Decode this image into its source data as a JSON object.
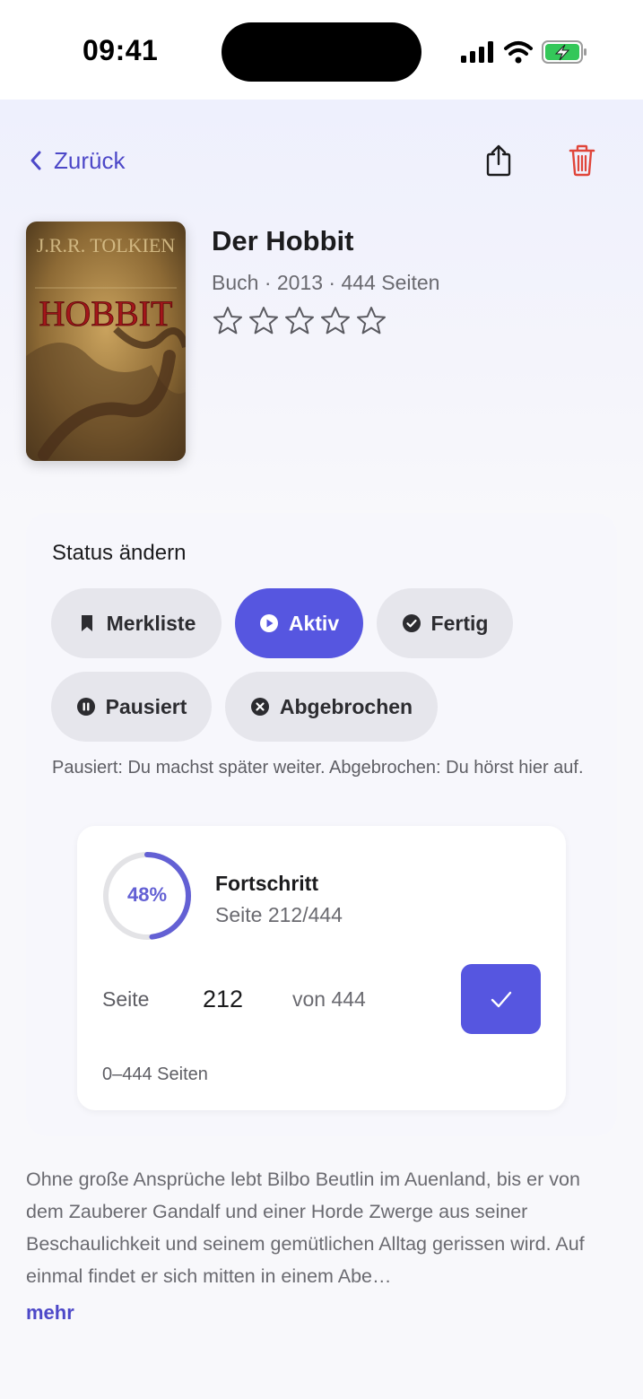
{
  "status_bar": {
    "time": "09:41"
  },
  "nav": {
    "back_label": "Zurück"
  },
  "book": {
    "title": "Der Hobbit",
    "meta": "Buch · 2013 · 444 Seiten",
    "rating": 0,
    "rating_max": 5,
    "cover_text": {
      "author": "J.R.R. TOLKIEN",
      "title": "HOBBIT"
    }
  },
  "status": {
    "heading": "Status ändern",
    "chips": [
      {
        "label": "Merkliste",
        "icon": "bookmark-icon",
        "active": false
      },
      {
        "label": "Aktiv",
        "icon": "play-icon",
        "active": true
      },
      {
        "label": "Fertig",
        "icon": "checkmark-circle-icon",
        "active": false
      },
      {
        "label": "Pausiert",
        "icon": "pause-icon",
        "active": false
      },
      {
        "label": "Abgebrochen",
        "icon": "x-circle-icon",
        "active": false
      }
    ],
    "hint": "Pausiert: Du machst später weiter. Abgebrochen: Du hörst hier auf."
  },
  "progress": {
    "percent_label": "48%",
    "fraction": 0.48,
    "title": "Fortschritt",
    "subtitle": "Seite 212/444",
    "page_label": "Seite",
    "page_value": "212",
    "of_label": "von 444",
    "range_label": "0–444 Seiten"
  },
  "description": {
    "text": "Ohne große Ansprüche lebt Bilbo Beutlin im Auenland, bis er von dem Zauberer Gandalf und einer Horde Zwerge aus seiner Beschaulichkeit und seinem gemütlichen Alltag gerissen wird. Auf einmal findet er sich mitten in einem Abe…",
    "more_label": "mehr"
  },
  "colors": {
    "accent": "#5656e0",
    "link": "#4d48c8",
    "danger": "#e0453a"
  }
}
